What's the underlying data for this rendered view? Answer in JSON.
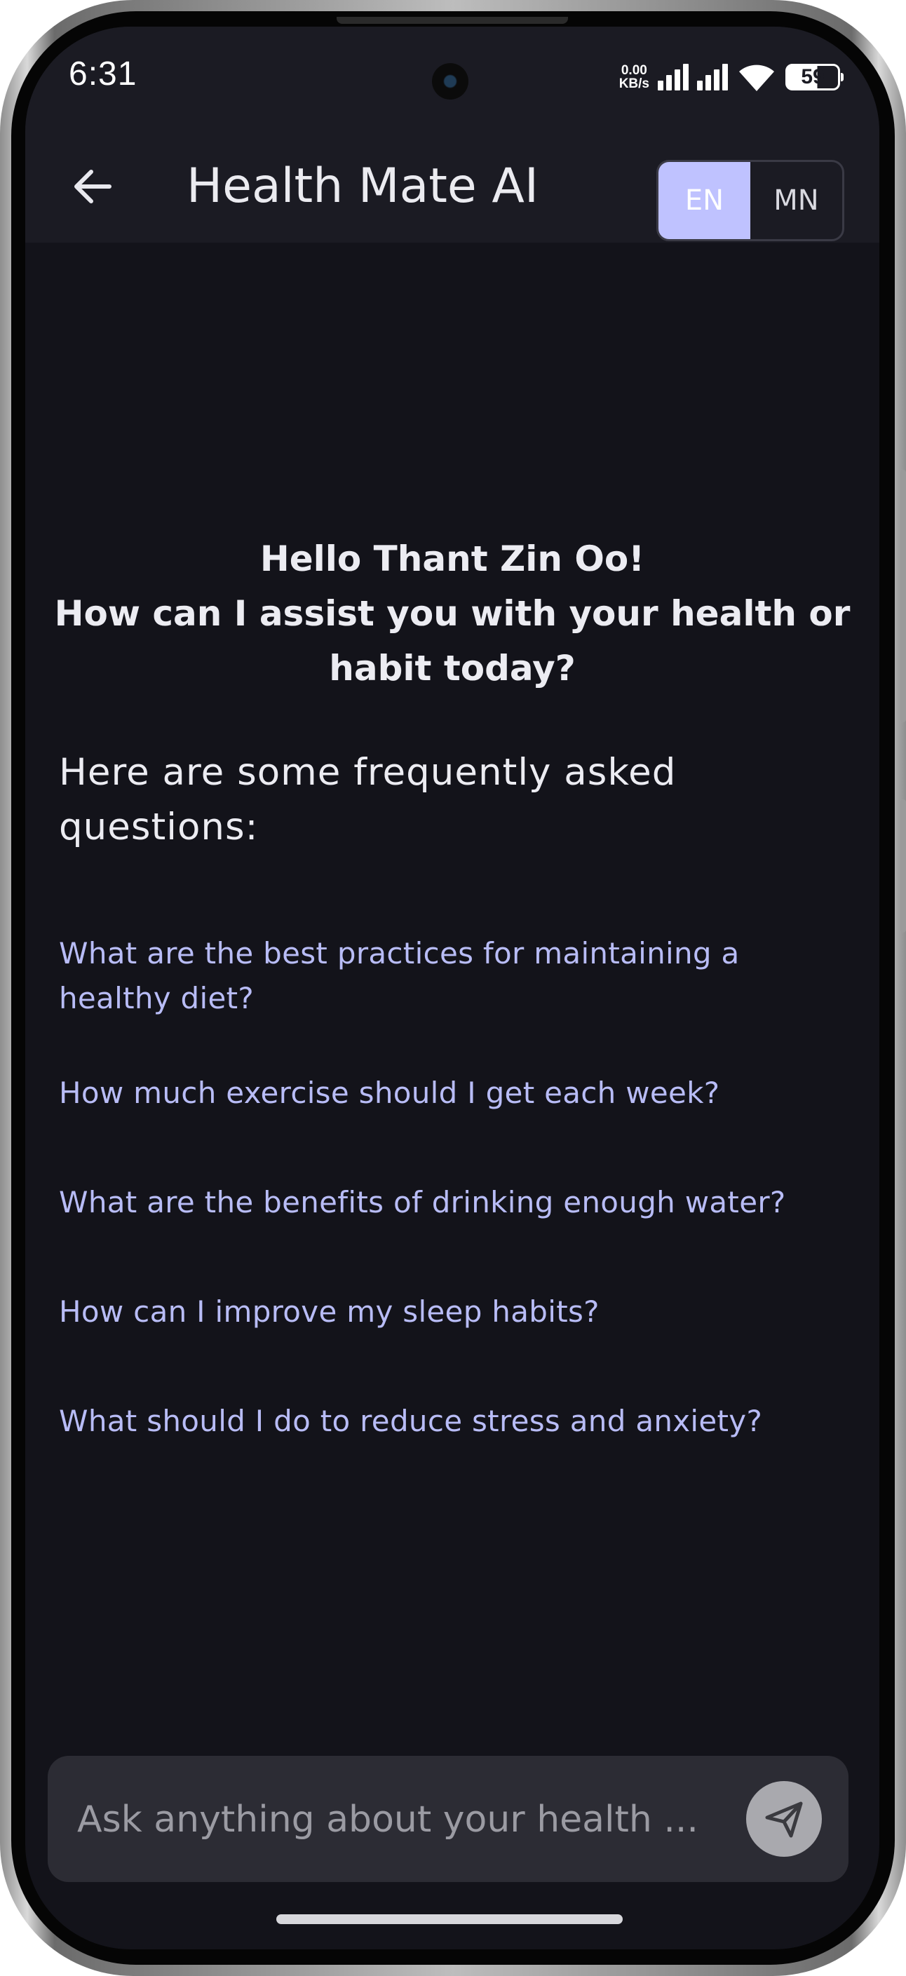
{
  "status_bar": {
    "time": "6:31",
    "net_speed_value": "0.00",
    "net_speed_unit": "KB/s",
    "battery": "59"
  },
  "app_bar": {
    "title": "Health Mate AI",
    "lang_en": "EN",
    "lang_mn": "MN",
    "active_lang": "EN"
  },
  "greeting": {
    "line1": "Hello Thant Zin Oo!",
    "line2": "How can I assist you with your health or habit today?"
  },
  "faq": {
    "heading": "Here are some frequently asked questions:",
    "items": [
      "What are the best practices for maintaining a healthy diet?",
      "How much exercise should I get each week?",
      "What are the benefits of drinking enough water?",
      "How can I improve my sleep habits?",
      "What should I do to reduce stress and anxiety?"
    ]
  },
  "composer": {
    "placeholder": "Ask anything about your health ..."
  },
  "colors": {
    "background": "#13131a",
    "app_bar": "#1b1b23",
    "accent": "#bfc2ff",
    "faq_link": "#b8bcf6",
    "input_bg": "#2c2c34"
  },
  "icons": {
    "back": "arrow-left-icon",
    "send": "send-plane-icon",
    "wifi": "wifi-icon",
    "signal": "signal-bars-icon",
    "battery": "battery-icon"
  }
}
